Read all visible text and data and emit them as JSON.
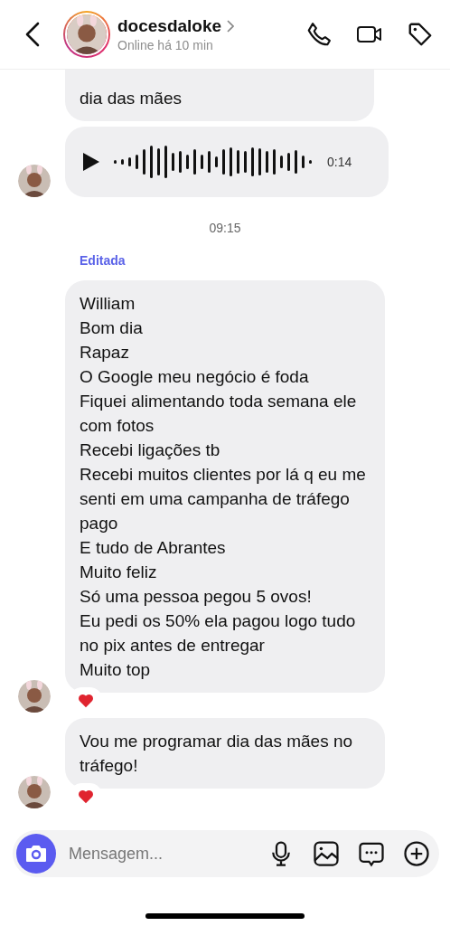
{
  "header": {
    "name": "docesdaloke",
    "status": "Online há 10 min"
  },
  "messages": [
    {
      "kind": "text",
      "lines": [
        "dia das mães"
      ],
      "avatar": false,
      "reaction": false,
      "clipped": true
    },
    {
      "kind": "audio",
      "duration": "0:14",
      "avatar": true
    },
    {
      "kind": "time",
      "text": "09:15"
    },
    {
      "kind": "text",
      "edited_label": "Editada",
      "lines": [
        "William",
        "Bom dia",
        "Rapaz",
        "O Google meu negócio é foda",
        "Fiquei alimentando toda semana ele com fotos",
        "Recebi ligações tb",
        "Recebi muitos clientes por lá q eu me senti em uma campanha de tráfego pago",
        "E tudo de Abrantes",
        "Muito feliz",
        "Só uma pessoa pegou 5 ovos!",
        "Eu pedi os 50% ela pagou logo tudo no pix antes de entregar",
        "Muito top"
      ],
      "avatar": true,
      "reaction": true
    },
    {
      "kind": "text",
      "lines": [
        "Vou me programar dia das mães no tráfego!"
      ],
      "avatar": true,
      "reaction": true
    }
  ],
  "composer": {
    "placeholder": "Mensagem..."
  }
}
